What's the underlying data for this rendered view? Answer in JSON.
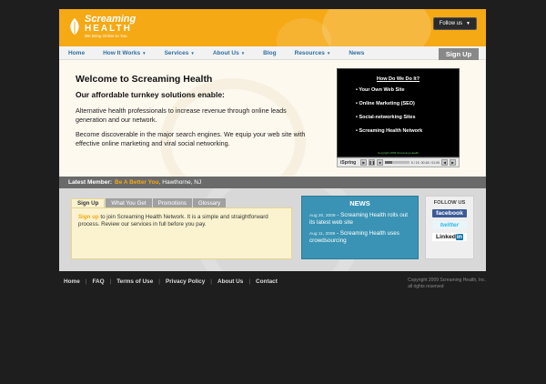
{
  "header": {
    "logo_name": "Screaming",
    "logo_name2": "HEALTH",
    "logo_tagline": "We Bring Online to You",
    "follow_label": "Follow us"
  },
  "nav": {
    "items": [
      "Home",
      "How It Works",
      "Services",
      "About Us",
      "Blog",
      "Resources",
      "News"
    ],
    "signup_label": "Sign Up"
  },
  "hero": {
    "title": "Welcome to Screaming Health",
    "subtitle": "Our affordable turnkey solutions enable:",
    "p1": "Alternative health professionals to increase revenue through online leads generation and our network.",
    "p2": "Become discoverable in the major search engines. We equip your web site with effective online marketing and viral social networking."
  },
  "video": {
    "title": "How Do We Do It?",
    "items": [
      "Your Own Web Site",
      "Online Marketing (SEO)",
      "Social-networking Sites",
      "Screaming Health Network"
    ],
    "copyright": "Copyright 2009 Screaming Health",
    "player_brand": "iSpring",
    "slide": "5 / 15",
    "time": "00:18 / 01:09",
    "progress": 0.3
  },
  "member": {
    "label": "Latest Member:",
    "name": "Be A Better You,",
    "location": "Hawthorne, NJ"
  },
  "tabs": {
    "items": [
      "Sign Up",
      "What You Get",
      "Promotions",
      "Glossary"
    ],
    "panel_link": "Sign up",
    "panel_text": " to join Screaming Health Network. It is a simple and straightforward process. Review our services in full before you pay."
  },
  "news": {
    "title": "NEWS",
    "items": [
      {
        "date": "Aug 20, 2009",
        "text": "Screaming Health rolls out its latest web site"
      },
      {
        "date": "Aug 11, 2009",
        "text": "Screaming Health uses crowdsourcing"
      }
    ]
  },
  "follow": {
    "title": "FOLLOW US",
    "facebook": "facebook",
    "twitter": "twitter",
    "linkedin": "Linked",
    "linkedin_in": "in"
  },
  "footer": {
    "links": [
      "Home",
      "FAQ",
      "Terms of Use",
      "Privacy Policy",
      "About Us",
      "Contact"
    ],
    "copyright": "Copyright 2009 Screaming Health, Inc.",
    "rights": "all rights reserved"
  },
  "colors": {
    "brand_orange": "#f5a915",
    "link_blue": "#2f6f9e",
    "news_blue": "#3a93b4",
    "background": "#1e1e1e"
  }
}
